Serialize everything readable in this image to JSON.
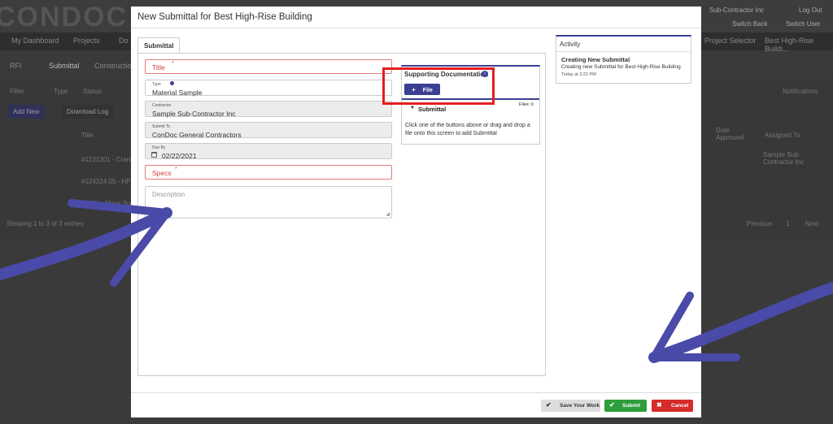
{
  "background": {
    "logo": "CONDOC",
    "top_right": [
      "Sub-Contractor Inc",
      "Log Out",
      "Switch Back",
      "Switch User"
    ],
    "nav": [
      "My Dashboard",
      "Projects",
      "Do"
    ],
    "nav_right": [
      "Project Selector",
      "Best High-Rise Buildi..."
    ],
    "tabs": [
      "RFI",
      "Submittal",
      "Construction"
    ],
    "filters": [
      "Filter",
      "Type",
      "Status"
    ],
    "actions": [
      "Add New",
      "Download Log"
    ],
    "notifications": "Notifications",
    "table": {
      "header": "Title",
      "rows": [
        "#1231201 - Crane",
        "#124224.05 - HPU S",
        "#1234 - Mass Sub"
      ],
      "right_headers": [
        "Date Approved",
        "Assigned To"
      ],
      "assigned": "Sample Sub-Contractor Inc"
    },
    "showing": "Showing 1 to 3 of 3 entries",
    "pagination": [
      "Previous",
      "1",
      "Next"
    ]
  },
  "modal": {
    "title": "New Submittal for Best High-Rise Building",
    "tab": "Submittal",
    "form": {
      "title_placeholder": "Title",
      "type_label": "Type",
      "type_value": "Material Sample",
      "contractor_label": "Contractor",
      "contractor_value": "Sample Sub-Contractor Inc",
      "submit_to_label": "Submit To",
      "submit_to_value": "ConDoc General Contractors",
      "due_by_label": "Due By",
      "due_by_value": "02/22/2021",
      "specs_placeholder": "Specs",
      "description_placeholder": "Description",
      "required_mark": "*"
    },
    "docs": {
      "title": "Supporting Documentation",
      "file_button": "File",
      "section": "Submittal",
      "files_count": "Files: 0",
      "drop_text": "Click one of the buttons above or drag and drop a file onto this screen to add Submittal"
    },
    "activity": {
      "header": "Activity",
      "item_title": "Creating New Submittal",
      "item_desc": "Creating new Submittal for Best High-Rise Building",
      "item_time": "Today at 3:22 PM"
    },
    "footer": {
      "save": "Save Your Work",
      "submit": "Submit",
      "cancel": "Cancel"
    }
  },
  "colors": {
    "accent": "#3b3f93",
    "required": "#d43a3a",
    "highlight": "#e41e1e",
    "arrow": "#4a4aa8",
    "submit": "#2e9e3c",
    "cancel": "#d52b2b"
  }
}
